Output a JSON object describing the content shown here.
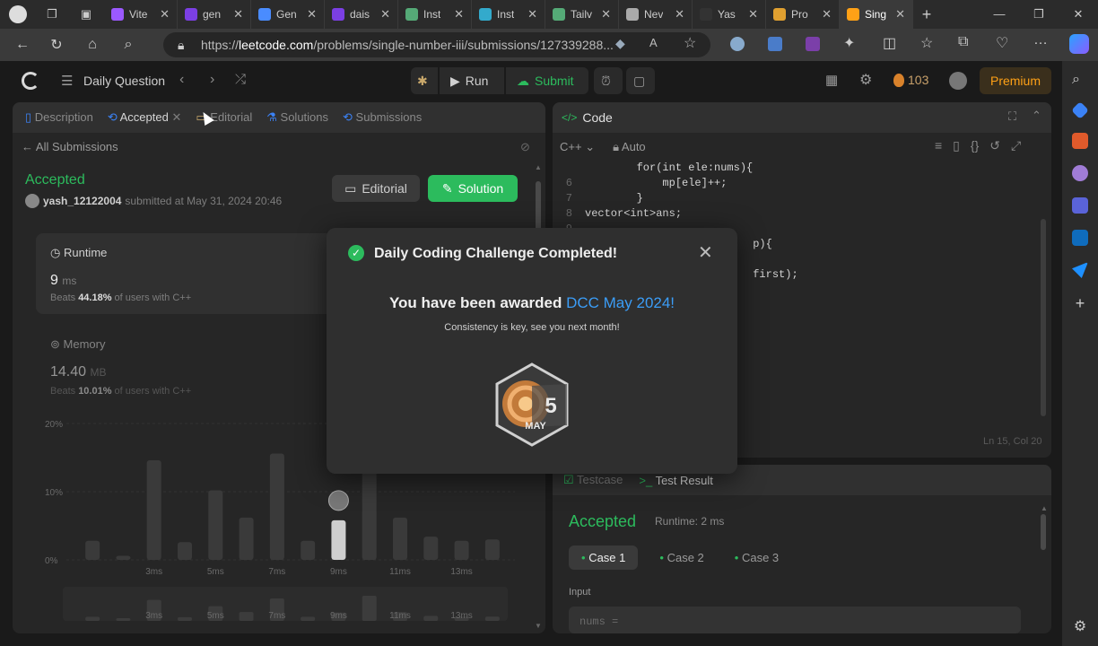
{
  "browser": {
    "tabs": [
      {
        "title": "Vite",
        "color": "#9b59ff"
      },
      {
        "title": "gen",
        "color": "#7b3fe4"
      },
      {
        "title": "Gen",
        "color": "#4a8cff"
      },
      {
        "title": "dais",
        "color": "#7b3fe4"
      },
      {
        "title": "Inst",
        "color": "#55aa77"
      },
      {
        "title": "Inst",
        "color": "#33aacc"
      },
      {
        "title": "Tailv",
        "color": "#55aa77"
      },
      {
        "title": "Nev",
        "color": "#aaaaaa"
      },
      {
        "title": "Yas",
        "color": "#333333"
      },
      {
        "title": "Pro",
        "color": "#e0a030"
      },
      {
        "title": "Sing",
        "color": "#ffa116",
        "active": true
      }
    ],
    "url_prefix": "https://",
    "url_domain": "leetcode.com",
    "url_rest": "/problems/single-number-iii/submissions/127339288..."
  },
  "header": {
    "daily_question": "Daily Question",
    "run": "Run",
    "submit": "Submit",
    "streak": "103",
    "premium": "Premium"
  },
  "left": {
    "tabs": [
      "Description",
      "Accepted",
      "Editorial",
      "Solutions",
      "Submissions"
    ],
    "all_submissions": "All Submissions",
    "status": "Accepted",
    "user": "yash_12122004",
    "submitted": "submitted at May 31, 2024 20:46",
    "editorial_btn": "Editorial",
    "solution_btn": "Solution",
    "runtime_label": "Runtime",
    "runtime_value": "9",
    "runtime_unit": "ms",
    "runtime_beats_pre": "Beats ",
    "runtime_beats_pct": "44.18%",
    "runtime_beats_post": " of users with C++",
    "memory_label": "Memory",
    "memory_value": "14.40",
    "memory_unit": "MB",
    "memory_beats_pre": "Beats ",
    "memory_beats_pct": "10.01%",
    "memory_beats_post": " of users with C++",
    "y_ticks": [
      "20%",
      "10%",
      "0%"
    ],
    "x_ticks": [
      "3ms",
      "5ms",
      "7ms",
      "9ms",
      "11ms",
      "13ms"
    ],
    "mini_ticks": [
      "3ms",
      "5ms",
      "7ms",
      "9ms",
      "11ms",
      "13ms"
    ]
  },
  "chart_data": {
    "type": "bar",
    "x": [
      "1ms",
      "2ms",
      "3ms",
      "4ms",
      "5ms",
      "6ms",
      "7ms",
      "8ms",
      "9ms",
      "10ms",
      "11ms",
      "12ms",
      "13ms",
      "14ms"
    ],
    "values": [
      2.8,
      0.6,
      14.6,
      2.6,
      10.2,
      6.2,
      15.6,
      2.8,
      5.8,
      17.5,
      6.2,
      3.4,
      2.8,
      3.0
    ],
    "ylim": [
      0,
      20
    ],
    "highlight_index": 8
  },
  "code": {
    "title": "Code",
    "lang": "C++",
    "mode": "Auto",
    "lines": [
      {
        "n": "",
        "text": "        for(int ele:nums){"
      },
      {
        "n": "6",
        "text": "            mp[ele]++;"
      },
      {
        "n": "7",
        "text": "        }"
      },
      {
        "n": "8",
        "text": "vector<int>ans;"
      },
      {
        "n": "9",
        "text": ""
      },
      {
        "n": "",
        "text": "                          p){"
      },
      {
        "n": "",
        "text": ""
      },
      {
        "n": "",
        "text": "                          first);"
      }
    ],
    "cursor": "Ln 15, Col 20"
  },
  "result": {
    "tab_testcase": "Testcase",
    "tab_result": "Test Result",
    "status": "Accepted",
    "runtime": "Runtime: 2 ms",
    "cases": [
      "Case 1",
      "Case 2",
      "Case 3"
    ],
    "input_label": "Input",
    "input_value": "nums ="
  },
  "modal": {
    "title": "Daily Coding Challenge Completed!",
    "awarded_pre": "You have been awarded ",
    "awarded_badge": "DCC May 2024!",
    "subtitle": "Consistency is key, see you next month!",
    "badge_number": "5",
    "badge_month": "MAY"
  },
  "colors": {
    "accent_green": "#2cbb5d",
    "premium": "#ffa116",
    "link_blue": "#3b9df7"
  }
}
